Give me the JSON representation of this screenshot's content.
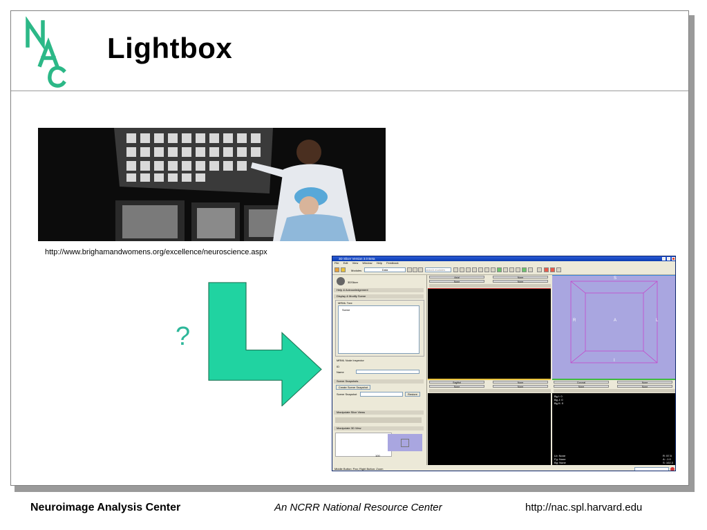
{
  "slide": {
    "title": "Lightbox",
    "logo_letters": "NAC",
    "photo_caption": "http://www.brighamandwomens.org/excellence/neuroscience.aspx",
    "question_mark": "?",
    "accent_color": "#2cb887"
  },
  "app": {
    "window_title": "3D Slicer Version 3.0 Beta",
    "menu": [
      "File",
      "Edit",
      "View",
      "Window",
      "Help",
      "Feedback"
    ],
    "modules_label": "Modules",
    "module_value": "Data",
    "search_placeholder": "search modules",
    "logo_text": "3DSlicer",
    "sections": {
      "help": "Help & Acknowledgement",
      "display": "Display & Modify Scene",
      "mrml_tree": "MRML Tree",
      "scene_node": "Scene",
      "node_inspector": "MRML Node Inspector",
      "id_label": "ID",
      "name_label": "Name",
      "snapshots": "Scene Snapshots",
      "create_snapshot": "Create Scene Snapshot",
      "snapshot_label": "Scene Snapshot",
      "restore": "Restore",
      "slice_views": "Manipulate Slice Views",
      "view3d": "Manipulate 3D View",
      "zoom_value": "100"
    },
    "viewers": {
      "axial": "Axial",
      "sagittal": "Sagittal",
      "coronal": "Coronal",
      "none": "None",
      "zero": "0",
      "labels_3d": {
        "top": "S",
        "left": "R",
        "right": "L",
        "center": "A",
        "bottom": "I"
      },
      "bg_readout": [
        "Bg I: 0",
        "Bg J: 0",
        "Bg K: 0"
      ],
      "lb_readout": [
        "Lb: None",
        "Fg: None",
        "Bg: None"
      ],
      "ras_readout": [
        "R: 57.5",
        "A: -1.0",
        "S: 102.3"
      ]
    },
    "status_text": "Middle Button: Pan; Right Button: Zoom"
  },
  "footer": {
    "left": "Neuroimage Analysis Center",
    "center": "An NCRR National Resource Center",
    "right": "http://nac.spl.harvard.edu"
  }
}
